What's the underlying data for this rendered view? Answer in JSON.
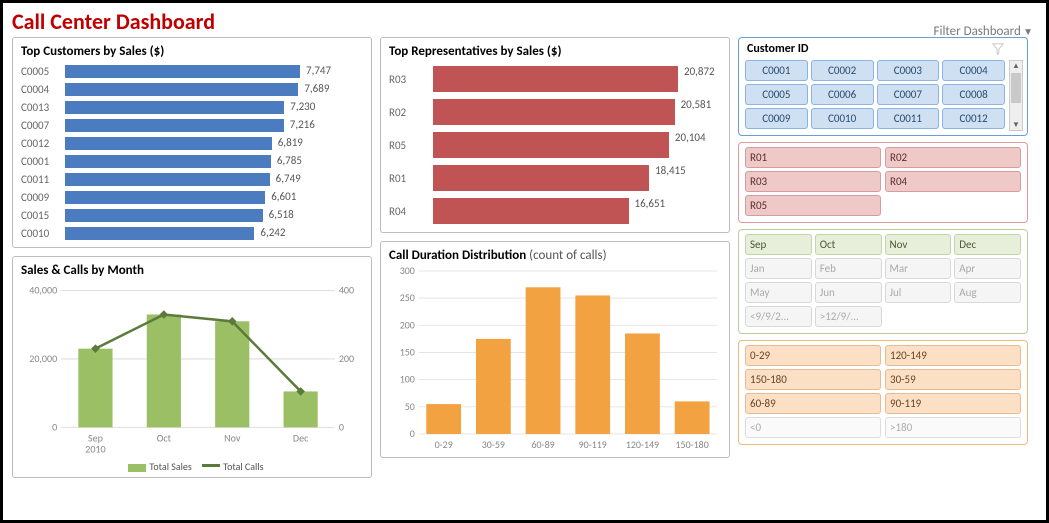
{
  "title": "Call Center Dashboard",
  "filter_label": "Filter Dashboard",
  "panels": {
    "topCustomers": {
      "title": "Top Customers by Sales ($)"
    },
    "topReps": {
      "title": "Top Representatives by Sales ($)"
    },
    "salesCalls": {
      "title": "Sales & Calls by Month"
    },
    "duration": {
      "title": "Call Duration Distribution",
      "subtitle": "(count of calls)"
    }
  },
  "slicers": {
    "customer": {
      "title": "Customer ID",
      "items": [
        "C0001",
        "C0002",
        "C0003",
        "C0004",
        "C0005",
        "C0006",
        "C0007",
        "C0008",
        "C0009",
        "C0010",
        "C0011",
        "C0012"
      ]
    },
    "rep": {
      "items": [
        "R01",
        "R02",
        "R03",
        "R04",
        "R05"
      ]
    },
    "month": {
      "active": [
        "Sep",
        "Oct",
        "Nov",
        "Dec"
      ],
      "inactive": [
        "Jan",
        "Feb",
        "Mar",
        "Apr",
        "May",
        "Jun",
        "Jul",
        "Aug",
        "<9/9/2...",
        ">12/9/..."
      ]
    },
    "duration": {
      "active": [
        "0-29",
        "120-149",
        "150-180",
        "30-59",
        "60-89",
        "90-119"
      ],
      "inactive": [
        "<0",
        ">180"
      ]
    }
  },
  "legend": {
    "sales": "Total Sales",
    "calls": "Total Calls"
  },
  "chart_data": [
    {
      "id": "topCustomers",
      "type": "bar",
      "orientation": "horizontal",
      "title": "Top Customers by Sales ($)",
      "categories": [
        "C0005",
        "C0004",
        "C0013",
        "C0007",
        "C0012",
        "C0001",
        "C0011",
        "C0009",
        "C0015",
        "C0010"
      ],
      "values": [
        7747,
        7689,
        7230,
        7216,
        6819,
        6785,
        6749,
        6601,
        6518,
        6242
      ],
      "color": "#4a7cbf"
    },
    {
      "id": "topReps",
      "type": "bar",
      "orientation": "horizontal",
      "title": "Top Representatives by Sales ($)",
      "categories": [
        "R03",
        "R02",
        "R05",
        "R01",
        "R04"
      ],
      "values": [
        20872,
        20581,
        20104,
        18415,
        16651
      ],
      "color": "#c05454"
    },
    {
      "id": "salesCalls",
      "type": "combo",
      "title": "Sales & Calls by Month",
      "categories": [
        "Sep",
        "Oct",
        "Nov",
        "Dec"
      ],
      "x_sub": "2010",
      "series": [
        {
          "name": "Total Sales",
          "type": "bar",
          "axis": "left",
          "values": [
            23000,
            33000,
            31000,
            10500
          ],
          "color": "#9bbf65"
        },
        {
          "name": "Total Calls",
          "type": "line",
          "axis": "right",
          "values": [
            230,
            330,
            310,
            105
          ],
          "color": "#5c7a3a"
        }
      ],
      "y_left": {
        "min": 0,
        "max": 40000,
        "ticks": [
          0,
          20000,
          40000
        ]
      },
      "y_right": {
        "min": 0,
        "max": 400,
        "ticks": [
          0,
          200,
          400
        ]
      }
    },
    {
      "id": "duration",
      "type": "bar",
      "title": "Call Duration Distribution (count of calls)",
      "categories": [
        "0-29",
        "30-59",
        "60-89",
        "90-119",
        "120-149",
        "150-180"
      ],
      "values": [
        55,
        175,
        270,
        255,
        185,
        60
      ],
      "ylim": [
        0,
        300
      ],
      "yticks": [
        0,
        50,
        100,
        150,
        200,
        250,
        300
      ],
      "color": "#f2a240"
    }
  ]
}
